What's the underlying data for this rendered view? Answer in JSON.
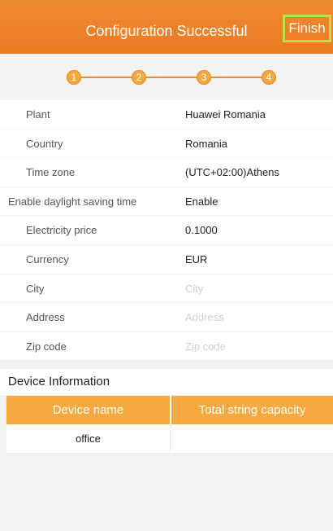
{
  "header": {
    "title": "Configuration Successful",
    "finish_label": "Finish",
    "brand_color": "#ea7a22"
  },
  "steps": [
    "1",
    "2",
    "3",
    "4"
  ],
  "fields": [
    {
      "label": "Plant",
      "value": "Huawei Romania",
      "placeholder": false
    },
    {
      "label": "Country",
      "value": "Romania",
      "placeholder": false
    },
    {
      "label": "Time zone",
      "value": "(UTC+02:00)Athens",
      "placeholder": false
    },
    {
      "label": "Enable daylight saving time",
      "value": "Enable",
      "placeholder": false
    },
    {
      "label": "Electricity price",
      "value": "0.1000",
      "placeholder": false
    },
    {
      "label": "Currency",
      "value": "EUR",
      "placeholder": false
    },
    {
      "label": "City",
      "value": "City",
      "placeholder": true
    },
    {
      "label": "Address",
      "value": "Address",
      "placeholder": true
    },
    {
      "label": "Zip code",
      "value": "Zip code",
      "placeholder": true
    }
  ],
  "device_section": {
    "title": "Device Information",
    "columns": [
      "Device name",
      "Total string capacity"
    ],
    "rows": [
      [
        "office",
        ""
      ]
    ]
  }
}
